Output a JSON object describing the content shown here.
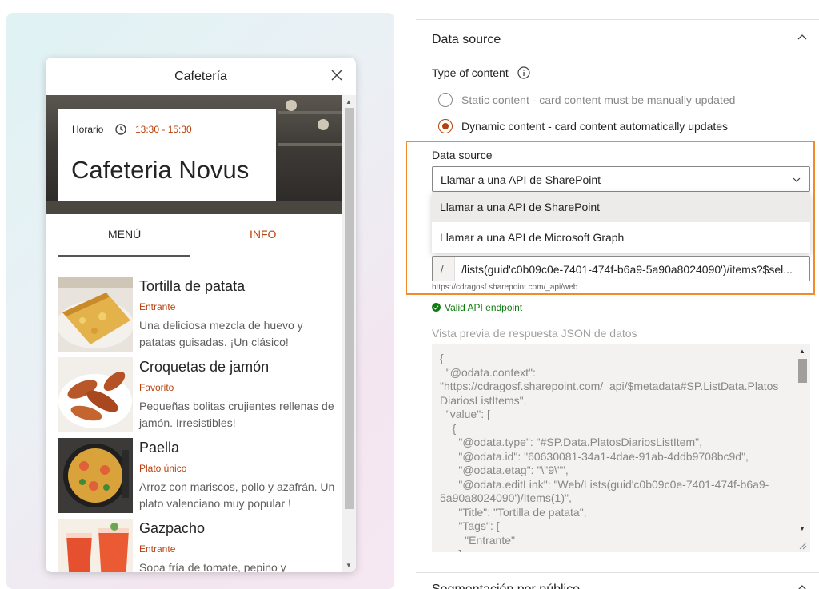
{
  "card": {
    "title": "Cafetería",
    "hours_label": "Horario",
    "hours_value": "13:30 - 15:30",
    "hero_title": "Cafeteria Novus",
    "tabs": [
      {
        "label": "MENÚ"
      },
      {
        "label": "INFO"
      }
    ],
    "items": [
      {
        "name": "Tortilla de patata",
        "tag": "Entrante",
        "desc": "Una deliciosa mezcla de huevo y patatas guisadas. ¡Un clásico!"
      },
      {
        "name": "Croquetas de jamón",
        "tag": "Favorito",
        "desc": "Pequeñas bolitas crujientes rellenas de jamón. Irresistibles!"
      },
      {
        "name": "Paella",
        "tag": "Plato único",
        "desc": "Arroz con mariscos, pollo y azafrán. Un plato valenciano muy popular !"
      },
      {
        "name": "Gazpacho",
        "tag": "Entrante",
        "desc": "Sopa fría de tomate, pepino y"
      }
    ]
  },
  "panel": {
    "section_title": "Data source",
    "type_label": "Type of content",
    "radios": [
      {
        "label": "Static content - card content must be manually updated",
        "checked": false
      },
      {
        "label": "Dynamic content - card content automatically updates",
        "checked": true
      }
    ],
    "data_source_label": "Data source",
    "select_value": "Llamar a una API de SharePoint",
    "options": [
      {
        "label": "Llamar a una API de SharePoint"
      },
      {
        "label": "Llamar a una API de Microsoft Graph"
      }
    ],
    "url_prefix": "/",
    "url_value": "/lists(guid'c0b09c0e-7401-474f-b6a9-5a90a8024090')/items?$sel...",
    "url_hint": "https://cdragosf.sharepoint.com/_api/web",
    "valid_text": "Valid API endpoint",
    "json_label": "Vista previa de respuesta JSON de datos",
    "json_preview": "{\n  \"@odata.context\":\n\"https://cdragosf.sharepoint.com/_api/$metadata#SP.ListData.Platos\nDiariosListItems\",\n  \"value\": [\n    {\n      \"@odata.type\": \"#SP.Data.PlatosDiariosListItem\",\n      \"@odata.id\": \"60630081-34a1-4dae-91ab-4ddb9708bc9d\",\n      \"@odata.etag\": \"\\\"9\\\"\",\n      \"@odata.editLink\": \"Web/Lists(guid'c0b09c0e-7401-474f-b6a9-\n5a90a8024090')/Items(1)\",\n      \"Title\": \"Tortilla de patata\",\n      \"Tags\": [\n        \"Entrante\"\n      ]",
    "bottom_section_title": "Segmentación por público"
  },
  "colors": {
    "accent": "#b7410e",
    "highlight": "#f28c2b",
    "valid": "#107c10"
  }
}
